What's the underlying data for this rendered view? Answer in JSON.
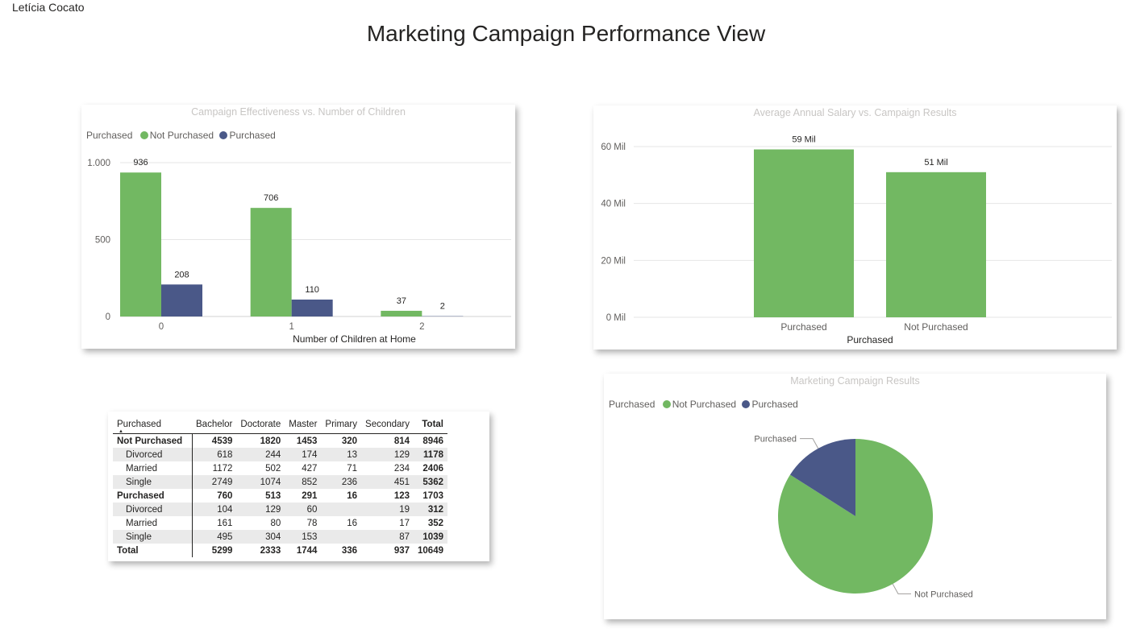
{
  "author": "Letícia Cocato",
  "page_title": "Marketing Campaign Performance View",
  "colors": {
    "not_purchased": "#72b862",
    "purchased": "#4a5888",
    "grid": "#e6e6e6",
    "axis_text": "#605e5c"
  },
  "children_chart": {
    "title": "Campaign Effectiveness vs. Number of Children",
    "legend_title": "Purchased",
    "legend_items": [
      "Not Purchased",
      "Purchased"
    ]
  },
  "salary_chart": {
    "title": "Average Annual Salary vs. Campaign Results"
  },
  "pie_chart": {
    "title": "Marketing Campaign Results",
    "legend_title": "Purchased",
    "legend_items": [
      "Not Purchased",
      "Purchased"
    ]
  },
  "matrix": {
    "columns": [
      "Purchased",
      "Bachelor",
      "Doctorate",
      "Master",
      "Primary",
      "Secondary",
      "Total"
    ],
    "rows": [
      {
        "label": "Not Purchased",
        "level": 0,
        "cells": [
          "4539",
          "1820",
          "1453",
          "320",
          "814",
          "8946"
        ]
      },
      {
        "label": "Divorced",
        "level": 1,
        "cells": [
          "618",
          "244",
          "174",
          "13",
          "129",
          "1178"
        ]
      },
      {
        "label": "Married",
        "level": 1,
        "cells": [
          "1172",
          "502",
          "427",
          "71",
          "234",
          "2406"
        ]
      },
      {
        "label": "Single",
        "level": 1,
        "cells": [
          "2749",
          "1074",
          "852",
          "236",
          "451",
          "5362"
        ]
      },
      {
        "label": "Purchased",
        "level": 0,
        "cells": [
          "760",
          "513",
          "291",
          "16",
          "123",
          "1703"
        ]
      },
      {
        "label": "Divorced",
        "level": 1,
        "cells": [
          "104",
          "129",
          "60",
          "",
          "19",
          "312"
        ]
      },
      {
        "label": "Married",
        "level": 1,
        "cells": [
          "161",
          "80",
          "78",
          "16",
          "17",
          "352"
        ]
      },
      {
        "label": "Single",
        "level": 1,
        "cells": [
          "495",
          "304",
          "153",
          "",
          "87",
          "1039"
        ]
      },
      {
        "label": "Total",
        "level": 0,
        "cells": [
          "5299",
          "2333",
          "1744",
          "336",
          "937",
          "10649"
        ]
      }
    ]
  },
  "chart_data": [
    {
      "type": "bar",
      "title": "Campaign Effectiveness vs. Number of Children",
      "xlabel": "Number of Children at Home",
      "ylabel": "",
      "categories": [
        "0",
        "1",
        "2"
      ],
      "series": [
        {
          "name": "Not Purchased",
          "values": [
            936,
            706,
            37
          ],
          "labels": [
            "936",
            "706",
            "37"
          ]
        },
        {
          "name": "Purchased",
          "values": [
            208,
            110,
            2
          ],
          "labels": [
            "208",
            "110",
            "2"
          ]
        }
      ],
      "ylim": [
        0,
        1000
      ],
      "yticks": [
        0,
        500,
        1000
      ],
      "ytick_labels": [
        "0",
        "500",
        "1.000"
      ],
      "legend": "top-left",
      "grid": true
    },
    {
      "type": "bar",
      "title": "Average Annual Salary vs. Campaign Results",
      "xlabel": "Purchased",
      "ylabel": "",
      "categories": [
        "Purchased",
        "Not Purchased"
      ],
      "values": [
        59,
        51
      ],
      "value_labels": [
        "59 Mil",
        "51 Mil"
      ],
      "unit": "Mil",
      "ylim": [
        0,
        60
      ],
      "yticks": [
        0,
        20,
        40,
        60
      ],
      "ytick_labels": [
        "0 Mil",
        "20 Mil",
        "40 Mil",
        "60 Mil"
      ],
      "grid": true
    },
    {
      "type": "pie",
      "title": "Marketing Campaign Results",
      "categories": [
        "Not Purchased",
        "Purchased"
      ],
      "values": [
        8946,
        1703
      ],
      "slice_labels": [
        "Not Purchased",
        "Purchased"
      ],
      "legend": "top-left"
    }
  ]
}
